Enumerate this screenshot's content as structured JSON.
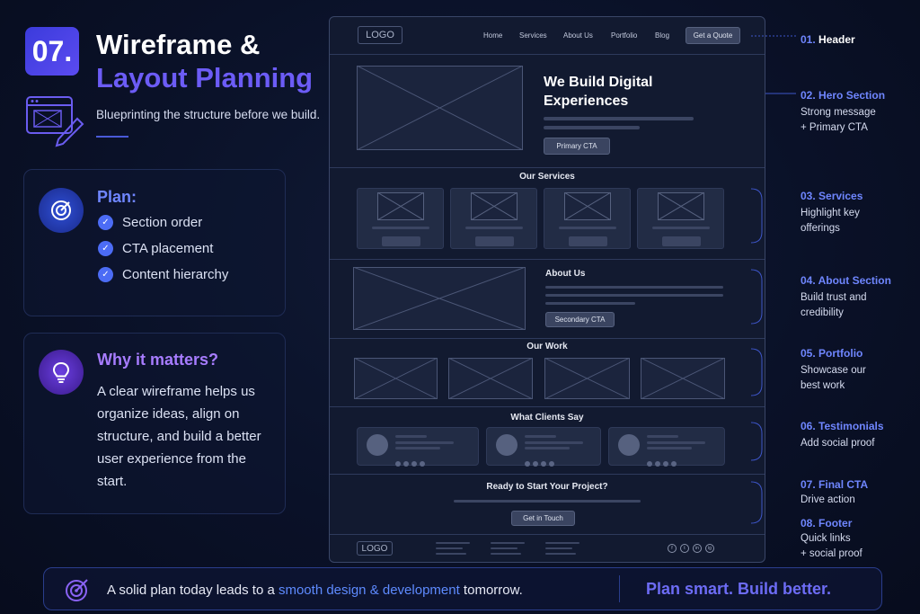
{
  "header": {
    "number": "07.",
    "title_line1": "Wireframe &",
    "title_line2": "Layout Planning",
    "subtitle": "Blueprinting the structure before we build."
  },
  "plan": {
    "title": "Plan:",
    "items": [
      "Section order",
      "CTA placement",
      "Content hierarchy"
    ]
  },
  "why": {
    "title": "Why it matters?",
    "text": "A clear wireframe helps us organize ideas, align on structure, and build a better user experience from the start."
  },
  "wireframe": {
    "logo": "LOGO",
    "nav": [
      "Home",
      "Services",
      "About Us",
      "Portfolio",
      "Blog"
    ],
    "nav_button": "Get a Quote",
    "hero_title": "We Build Digital Experiences",
    "hero_cta": "Primary CTA",
    "services_title": "Our Services",
    "about_title": "About Us",
    "about_cta": "Secondary CTA",
    "work_title": "Our Work",
    "clients_title": "What Clients Say",
    "cta_title": "Ready to Start Your Project?",
    "cta_button": "Get in Touch",
    "footer_logo": "LOGO",
    "social": [
      "f",
      "t",
      "in",
      "ig"
    ]
  },
  "labels": [
    {
      "num": "01.",
      "title": "Header",
      "desc": ""
    },
    {
      "num": "02.",
      "title": "Hero Section",
      "desc": "Strong message\n+ Primary CTA"
    },
    {
      "num": "03.",
      "title": "Services",
      "desc": "Highlight key\nofferings"
    },
    {
      "num": "04.",
      "title": "About Section",
      "desc": "Build trust and\ncredibility"
    },
    {
      "num": "05.",
      "title": "Portfolio",
      "desc": "Showcase our\nbest work"
    },
    {
      "num": "06.",
      "title": "Testimonials",
      "desc": "Add social proof"
    },
    {
      "num": "07.",
      "title": "Final CTA",
      "desc": "Drive action"
    },
    {
      "num": "08.",
      "title": "Footer",
      "desc": "Quick links\n+ social proof"
    }
  ],
  "banner": {
    "text_before": "A solid plan today leads to a ",
    "text_highlight": "smooth design & development",
    "text_after": " tomorrow.",
    "right": "Plan smart. Build better."
  },
  "colors": {
    "accent_blue": "#6f86ff",
    "accent_purple": "#a77cff",
    "background": "#0a1128"
  }
}
